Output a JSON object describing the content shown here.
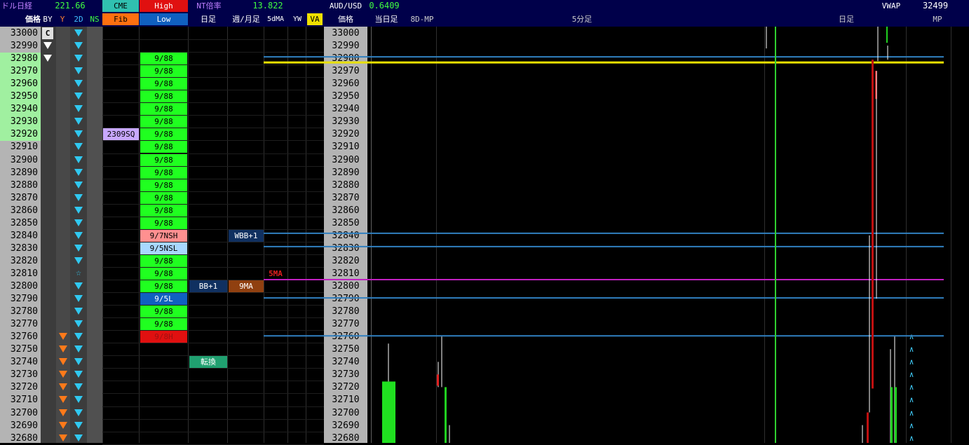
{
  "header": {
    "dollar_nikkei_label": "ドル日経",
    "dollar_nikkei_value": "221.66",
    "cme_label": "CME",
    "high_label": "High",
    "nt_label": "NT倍率",
    "nt_value": "13.822",
    "audusd_label": "AUD/USD",
    "audusd_value": "0.6409",
    "vwap_label": "VWAP",
    "vwap_value": "32499",
    "col_price": "価格",
    "col_by": "BY",
    "col_y": "Y",
    "col_2d": "2D",
    "col_ns": "NS",
    "col_fib": "Fib",
    "col_low": "Low",
    "col_daily": "日足",
    "col_weekly": "週/月足",
    "col_5dma": "5dMA",
    "col_yw": "YW",
    "col_va": "VA",
    "col_price2": "価格",
    "col_today": "当日足",
    "col_8dmp": "8D-MP",
    "col_5min": "5分足",
    "col_daily2": "日足",
    "col_mp": "MP"
  },
  "prices": [
    "33000",
    "32990",
    "32980",
    "32970",
    "32960",
    "32950",
    "32940",
    "32930",
    "32920",
    "32910",
    "32900",
    "32890",
    "32880",
    "32870",
    "32860",
    "32850",
    "32840",
    "32830",
    "32820",
    "32810",
    "32800",
    "32790",
    "32780",
    "32770",
    "32760",
    "32750",
    "32740",
    "32730",
    "32720",
    "32710",
    "32700",
    "32690",
    "32680"
  ],
  "by_col": {
    "c_label": "C"
  },
  "star_symbol": "☆",
  "mp_symbol": "∧",
  "fib_tag": "2309SQ",
  "low_col_default": "9/88",
  "low_col_special": {
    "nsh": "9/7NSH",
    "nsl": "9/5NSL",
    "l": "9/5L",
    "h": "9/8H"
  },
  "daily_bb": "BB+1",
  "daily_tenkan": "転換",
  "weekly_wbb": "WBB+1",
  "weekly_9ma": "9MA",
  "ma5_label": "5MA",
  "colors": {
    "header_bg": "#00004a",
    "green_cell": "#20ff20",
    "light_green_price": "#a0f0a0",
    "cyan_triangle": "#30c8f0",
    "orange_triangle": "#ff7a1a",
    "yellow_line": "#e8e000",
    "magenta_line": "#c020c0",
    "blue_line": "#3080c0"
  }
}
